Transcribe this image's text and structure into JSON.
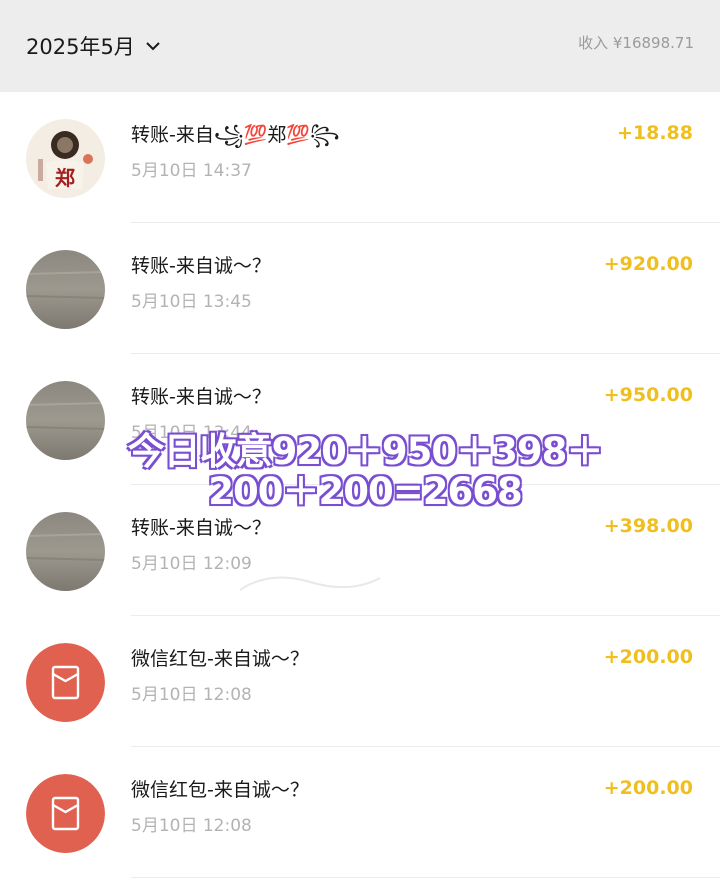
{
  "header": {
    "month_label": "2025年5月",
    "income_label": "收入 ¥16898.71"
  },
  "colors": {
    "amount": "#efbf1f",
    "red_packet": "#e0614f",
    "header_bg": "#ededed"
  },
  "transactions": [
    {
      "title": "转账-来自꧁💯郑💯꧂",
      "time": "5月10日 14:37",
      "amount": "+18.88",
      "avatar": "photo-avatar"
    },
    {
      "title": "转账-来自诚～？",
      "time": "5月10日 13:45",
      "amount": "+920.00",
      "avatar": "gray-avatar"
    },
    {
      "title": "转账-来自诚～？",
      "time": "5月10日 13:44",
      "amount": "+950.00",
      "avatar": "gray-avatar"
    },
    {
      "title": "转账-来自诚～？",
      "time": "5月10日 12:09",
      "amount": "+398.00",
      "avatar": "gray-avatar"
    },
    {
      "title": "微信红包-来自诚～？",
      "time": "5月10日 12:08",
      "amount": "+200.00",
      "avatar": "red-packet-icon"
    },
    {
      "title": "微信红包-来自诚～？",
      "time": "5月10日 12:08",
      "amount": "+200.00",
      "avatar": "red-packet-icon"
    }
  ],
  "overlay": {
    "line1": "今日收意920＋950＋398＋",
    "line2": "200＋200=2668"
  }
}
